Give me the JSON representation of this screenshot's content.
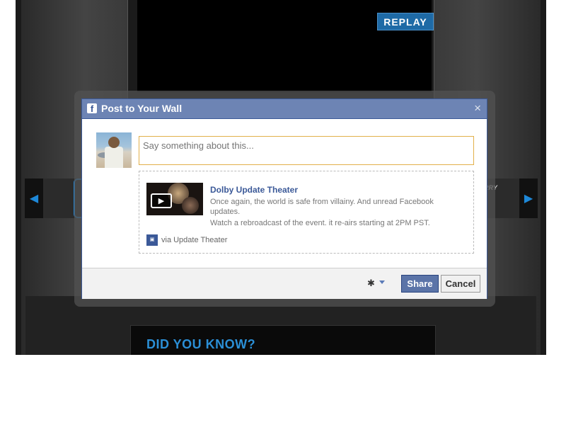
{
  "background": {
    "replay_label": "REPLAY",
    "band_text": "RRY",
    "did_you_know": "DID YOU KNOW?",
    "accent_color": "#2b8fd6"
  },
  "dialog": {
    "title": "Post to Your Wall",
    "close_glyph": "×",
    "status_placeholder": "Say something about this...",
    "attachment": {
      "title": "Dolby Update Theater",
      "caption": "Once again, the world is safe from villainy. And unread Facebook updates.",
      "description": "Watch a rebroadcast of the event. it re-airs starting at 2PM PST.",
      "via": "via Update Theater"
    },
    "footer": {
      "gear_icon": "gear-icon",
      "share_label": "Share",
      "cancel_label": "Cancel"
    }
  },
  "colors": {
    "facebook_blue": "#3b5998",
    "titlebar": "#6d84b4",
    "input_border": "#e2b04a"
  }
}
